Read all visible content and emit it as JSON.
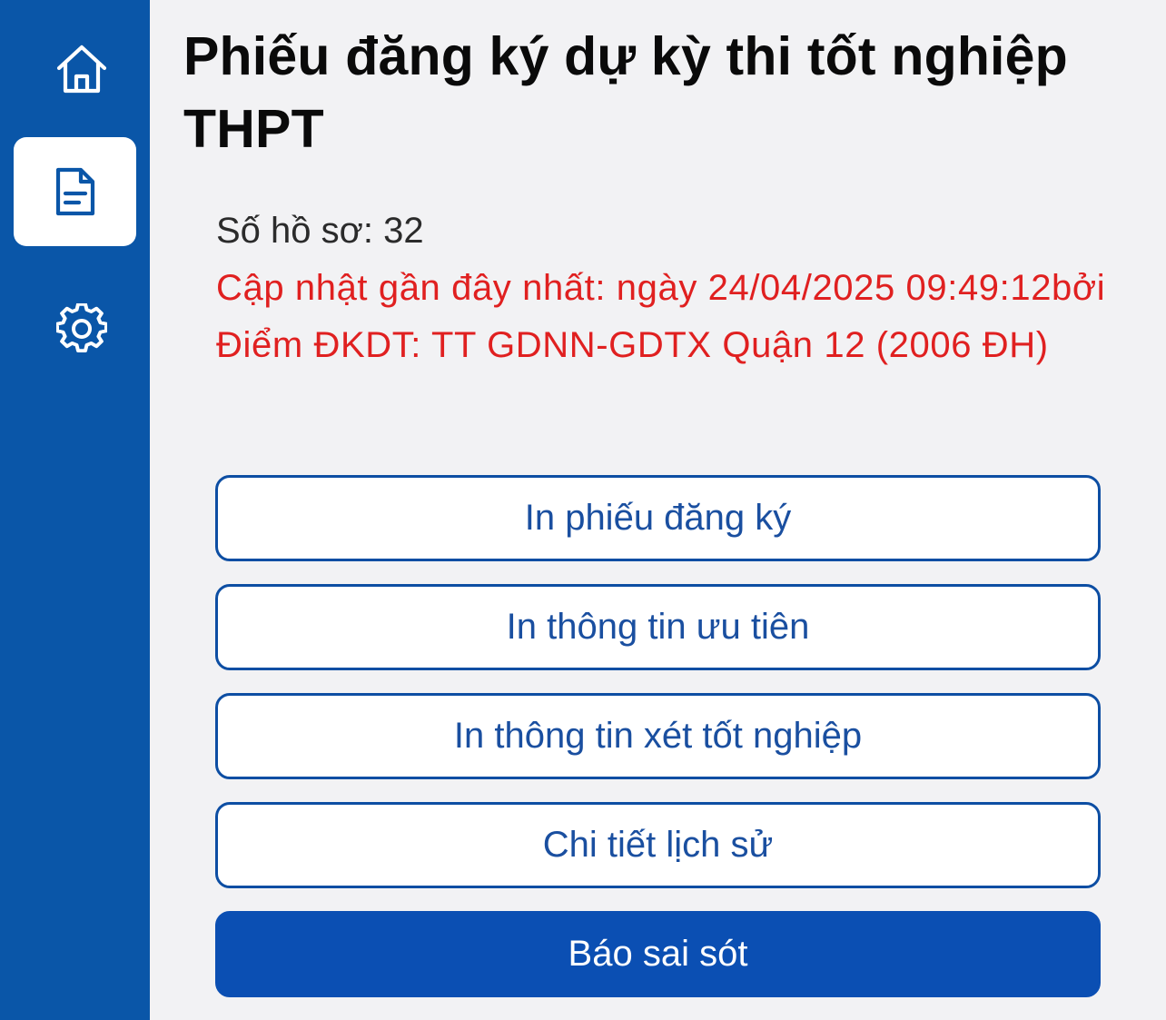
{
  "sidebar": {
    "items": [
      {
        "name": "home",
        "icon": "home-icon",
        "active": false
      },
      {
        "name": "document",
        "icon": "document-icon",
        "active": true
      },
      {
        "name": "settings",
        "icon": "gear-icon",
        "active": false
      }
    ]
  },
  "main": {
    "title": "Phiếu đăng ký dự kỳ thi tốt nghiệp THPT",
    "record_number": "Số hồ sơ: 32",
    "update_note": "Cập nhật gần đây nhất: ngày 24/04/2025 09:49:12bởi Điểm ĐKDT: TT GDNN-GDTX Quận 12 (2006 ĐH)",
    "buttons": [
      {
        "label": "In phiếu đăng ký"
      },
      {
        "label": "In thông tin ưu tiên"
      },
      {
        "label": "In thông tin xét tốt nghiệp"
      },
      {
        "label": "Chi tiết lịch sử"
      },
      {
        "label": "Báo sai sót"
      }
    ]
  },
  "colors": {
    "sidebar_bg": "#0a56a8",
    "page_bg": "#f2f2f4",
    "accent": "#0b4fb3",
    "alert_text": "#e02020"
  }
}
